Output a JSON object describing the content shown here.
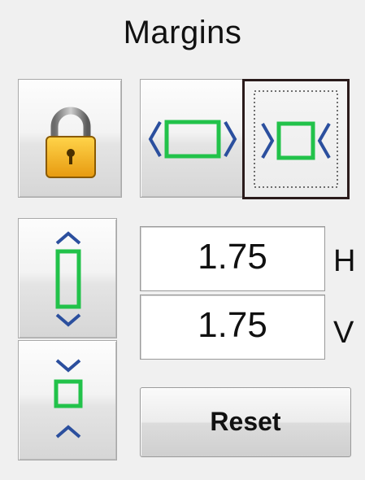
{
  "panel": {
    "title": "Margins"
  },
  "buttons": {
    "lock": {
      "icon": "lock-icon"
    },
    "expand_horizontal": {
      "icon": "expand-horizontal-icon"
    },
    "shrink_horizontal": {
      "icon": "shrink-horizontal-icon",
      "selected": true
    },
    "expand_vertical": {
      "icon": "expand-vertical-icon"
    },
    "shrink_vertical": {
      "icon": "shrink-vertical-icon"
    },
    "reset_label": "Reset"
  },
  "fields": {
    "horizontal": {
      "value": "1.75",
      "label": "H"
    },
    "vertical": {
      "value": "1.75",
      "label": "V"
    }
  },
  "colors": {
    "arrow": "#2b4f9e",
    "box": "#22c24a",
    "lock_body": "#f2b21f",
    "selected_border": "#2a1b1b"
  }
}
